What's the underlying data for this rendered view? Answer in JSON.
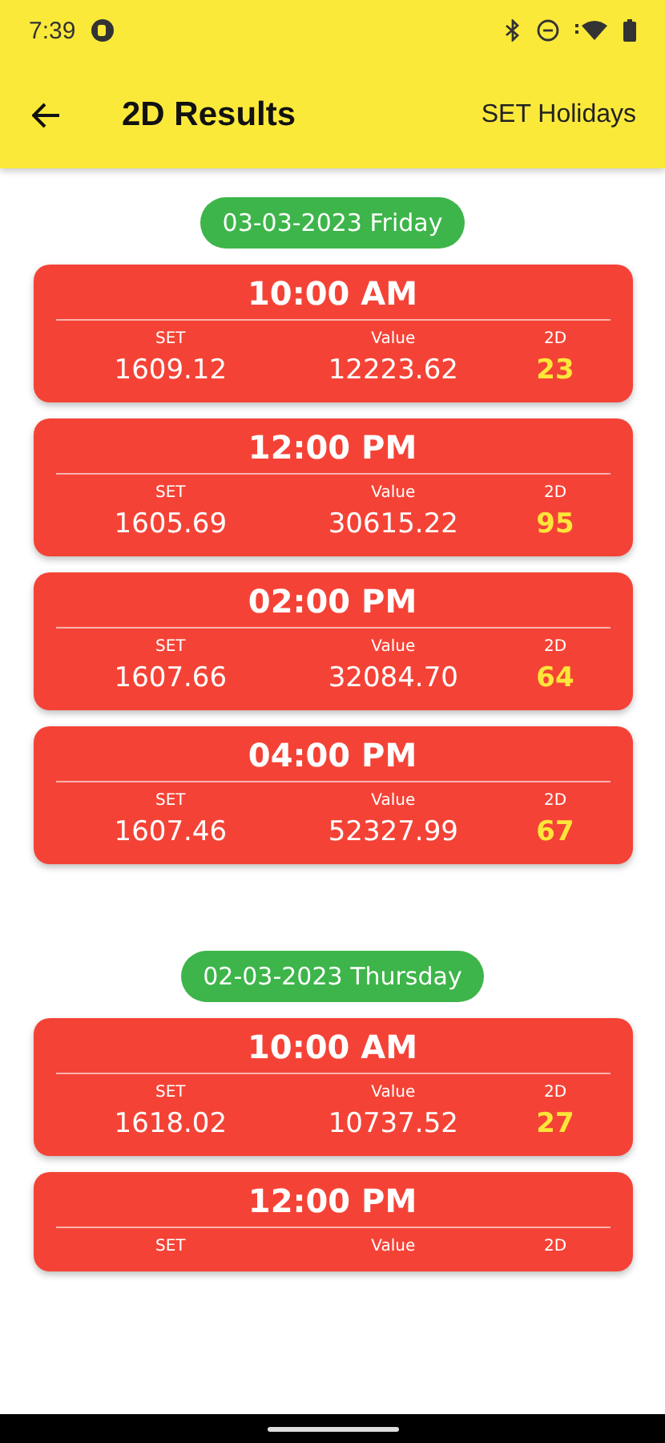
{
  "status_bar": {
    "time": "7:39"
  },
  "app_bar": {
    "title": "2D Results",
    "action": "SET Holidays"
  },
  "days": [
    {
      "date": "03-03-2023 Friday",
      "results": [
        {
          "time": "10:00 AM",
          "labels": [
            "SET",
            "Value",
            "2D"
          ],
          "set": "1609.12",
          "value": "12223.62",
          "twod": "23"
        },
        {
          "time": "12:00 PM",
          "labels": [
            "SET",
            "Value",
            "2D"
          ],
          "set": "1605.69",
          "value": "30615.22",
          "twod": "95"
        },
        {
          "time": "02:00 PM",
          "labels": [
            "SET",
            "Value",
            "2D"
          ],
          "set": "1607.66",
          "value": "32084.70",
          "twod": "64"
        },
        {
          "time": "04:00 PM",
          "labels": [
            "SET",
            "Value",
            "2D"
          ],
          "set": "1607.46",
          "value": "52327.99",
          "twod": "67"
        }
      ]
    },
    {
      "date": "02-03-2023 Thursday",
      "results": [
        {
          "time": "10:00 AM",
          "labels": [
            "SET",
            "Value",
            "2D"
          ],
          "set": "1618.02",
          "value": "10737.52",
          "twod": "27"
        },
        {
          "time": "12:00 PM",
          "labels": [
            "SET",
            "Value",
            "2D"
          ]
        }
      ]
    }
  ]
}
